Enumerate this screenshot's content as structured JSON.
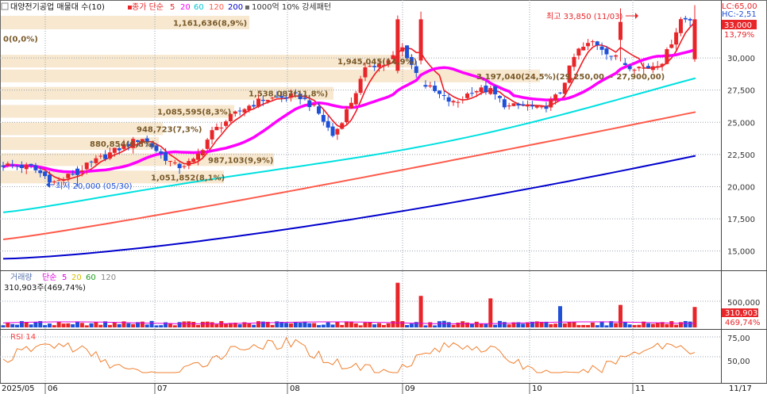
{
  "header": {
    "checkbox_label": "대양전기공업 매물대 수(10)",
    "ma_price": {
      "prefix": "종가 단순",
      "periods": [
        "5",
        "20",
        "60",
        "120",
        "200"
      ]
    },
    "pattern": "1000억 10% 강세패턴"
  },
  "volume_header": {
    "title": "거래량",
    "ma_prefix": "단순",
    "periods": [
      "5",
      "20",
      "60",
      "120"
    ],
    "value_text": "310,903주(469,74%)"
  },
  "rsi_header": {
    "title": "RSI 14"
  },
  "price_axis": {
    "ticks": [
      "30,000",
      "27,500",
      "25,000",
      "22,500",
      "20,000",
      "17,500",
      "15,000"
    ],
    "lc": "LC:65,00",
    "hc": "HC:-2,51",
    "current": "33,000",
    "current_pct": "13,79%"
  },
  "volume_axis": {
    "ticks": [
      "500,000"
    ],
    "current": "310,903",
    "current_pct": "469,74%"
  },
  "rsi_axis": {
    "ticks": [
      "75,00",
      "50,00"
    ]
  },
  "x_axis": {
    "labels": [
      "2025/05",
      "06",
      "07",
      "08",
      "09",
      "10",
      "11"
    ],
    "end_label": "11/17"
  },
  "annotations": {
    "high": "최고 33,850 (11/03)",
    "low": "최저 20,000 (05/30)",
    "range_text": "3,197,040(24,5%)(29,250,00 ~ 27,900,00)"
  },
  "chart_data": {
    "type": "candlestick",
    "x_labels": [
      "2025/05",
      "06",
      "07",
      "08",
      "09",
      "10",
      "11",
      "11/17"
    ],
    "ylim": [
      13500,
      34500
    ],
    "price_ticks": [
      30000,
      27500,
      25000,
      22500,
      20000,
      17500,
      15000
    ],
    "high": {
      "value": 33850,
      "date": "11/03"
    },
    "low": {
      "value": 20000,
      "date": "05/30"
    },
    "current_close": 33000,
    "volume_profile": [
      {
        "label": "0(0,0%)",
        "price": 31500
      },
      {
        "label": "1,161,636(8,9%)",
        "price": 32750
      },
      {
        "label": "1,945,045(14,9%)",
        "price": 29750
      },
      {
        "label": "3,197,040(24,5%)(29,250,00 ~ 27,900,00)",
        "price": 28600
      },
      {
        "label": "1,538,087(11,8%)",
        "price": 27250
      },
      {
        "label": "1,085,595(8,3%)",
        "price": 25850
      },
      {
        "label": "948,723(7,3%)",
        "price": 24500
      },
      {
        "label": "880,854(6,8%)",
        "price": 23350
      },
      {
        "label": "987,103(9,9%)",
        "price": 22100
      },
      {
        "label": "1,051,852(8,1%)",
        "price": 20750
      }
    ],
    "moving_averages": [
      {
        "name": "5",
        "color": "#ee1c24"
      },
      {
        "name": "20",
        "color": "#ff00ff"
      },
      {
        "name": "60",
        "color": "#00e0e0"
      },
      {
        "name": "120",
        "color": "#ff5a4a"
      },
      {
        "name": "200",
        "color": "#0000cc"
      }
    ],
    "volume_last": 310903,
    "volume_last_pct": "469,74%",
    "rsi_period": 14,
    "rsi_ticks": [
      75,
      50
    ]
  },
  "colors": {
    "up": "#e8262a",
    "down": "#1f50d8",
    "band": "#f7e8cf",
    "grid": "#9aa3b0",
    "axis_bg": "#ffffff"
  }
}
